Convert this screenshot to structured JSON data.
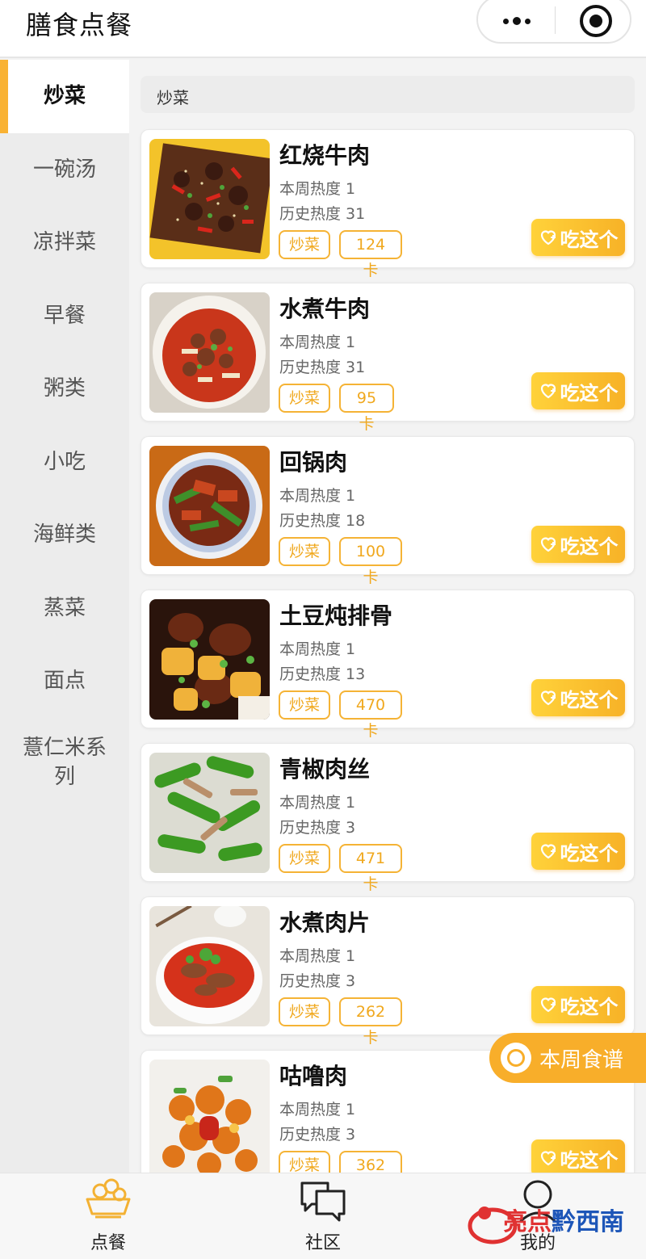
{
  "header": {
    "title": "膳食点餐"
  },
  "sidebar": {
    "items": [
      {
        "label": "炒菜"
      },
      {
        "label": "一碗汤"
      },
      {
        "label": "凉拌菜"
      },
      {
        "label": "早餐"
      },
      {
        "label": "粥类"
      },
      {
        "label": "小吃"
      },
      {
        "label": "海鲜类"
      },
      {
        "label": "蒸菜"
      },
      {
        "label": "面点"
      },
      {
        "label": "薏仁米系列"
      }
    ],
    "active_index": 0
  },
  "search": {
    "value": "炒菜"
  },
  "dishes": [
    {
      "name": "红烧牛肉",
      "week": "本周热度 1",
      "history": "历史热度 31",
      "tag": "炒菜",
      "calories": "124卡",
      "action": "吃这个"
    },
    {
      "name": "水煮牛肉",
      "week": "本周热度 1",
      "history": "历史热度 31",
      "tag": "炒菜",
      "calories": "95卡",
      "action": "吃这个"
    },
    {
      "name": "回锅肉",
      "week": "本周热度 1",
      "history": "历史热度 18",
      "tag": "炒菜",
      "calories": "100卡",
      "action": "吃这个"
    },
    {
      "name": "土豆炖排骨",
      "week": "本周热度 1",
      "history": "历史热度 13",
      "tag": "炒菜",
      "calories": "470卡",
      "action": "吃这个"
    },
    {
      "name": "青椒肉丝",
      "week": "本周热度 1",
      "history": "历史热度 3",
      "tag": "炒菜",
      "calories": "471卡",
      "action": "吃这个"
    },
    {
      "name": "水煮肉片",
      "week": "本周热度 1",
      "history": "历史热度 3",
      "tag": "炒菜",
      "calories": "262卡",
      "action": "吃这个"
    },
    {
      "name": "咕噜肉",
      "week": "本周热度 1",
      "history": "历史热度 3",
      "tag": "炒菜",
      "calories": "362卡",
      "action": "吃这个"
    }
  ],
  "floating": {
    "weekly_menu": "本周食谱"
  },
  "tabbar": [
    {
      "label": "点餐",
      "icon": "food-basket-icon"
    },
    {
      "label": "社区",
      "icon": "chat-bubbles-icon"
    },
    {
      "label": "我的",
      "icon": "user-icon"
    }
  ],
  "watermark": {
    "part1": "亮点",
    "part2": "黔西南"
  },
  "colors": {
    "accent": "#f8ae2a",
    "tag": "#f5b335",
    "sidebar_bg": "#ececec"
  }
}
